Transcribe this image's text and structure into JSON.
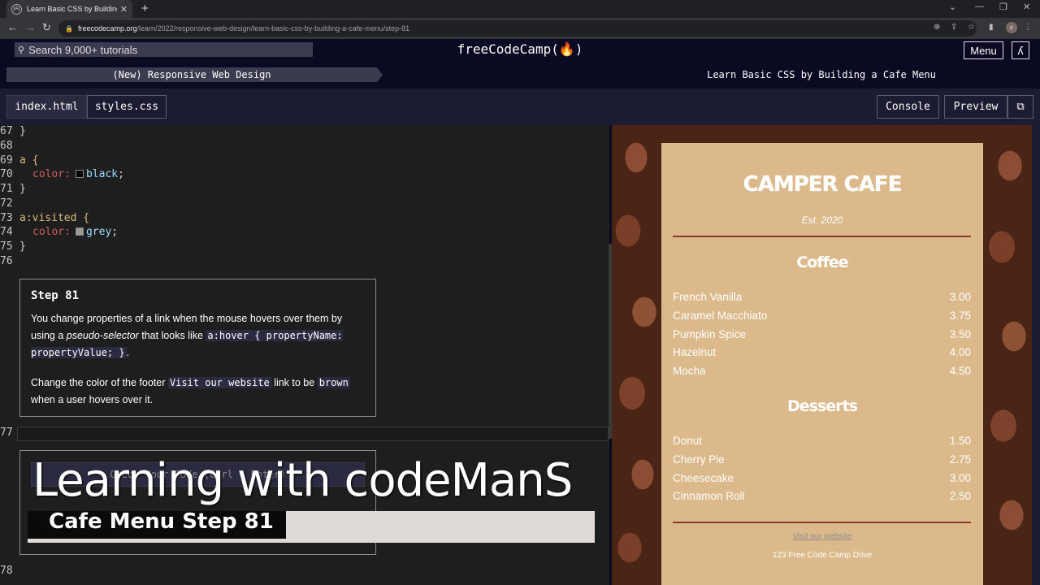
{
  "browser": {
    "tab_title": "Learn Basic CSS by Building a Cafe Menu",
    "tab_favicon": "(A)",
    "new_tab": "+",
    "url_host": "freecodecamp.org",
    "url_path": "/learn/2022/responsive-web-design/learn-basic-css-by-building-a-cafe-menu/step-81",
    "profile_initial": "c"
  },
  "nav": {
    "search_placeholder": "Search 9,000+ tutorials",
    "logo": "freeCodeCamp(🔥)",
    "menu_label": "Menu"
  },
  "breadcrumb": {
    "superblock": "(New) Responsive Web Design",
    "block": "Learn Basic CSS by Building a Cafe Menu"
  },
  "editor_tabs": {
    "files": [
      "index.html",
      "styles.css"
    ],
    "active": "styles.css",
    "console_label": "Console",
    "preview_label": "Preview"
  },
  "code_lines": [
    {
      "n": "67",
      "text": "}"
    },
    {
      "n": "68",
      "text": ""
    },
    {
      "n": "69",
      "text": "a {"
    },
    {
      "n": "70",
      "prop": "color:",
      "swatch": "#000000",
      "val": "black",
      "end": ";"
    },
    {
      "n": "71",
      "text": "}"
    },
    {
      "n": "72",
      "text": ""
    },
    {
      "n": "73",
      "text": "a:visited {"
    },
    {
      "n": "74",
      "prop": "color:",
      "swatch": "#9a9a9a",
      "val": "grey",
      "end": ";"
    },
    {
      "n": "75",
      "text": "}"
    },
    {
      "n": "76",
      "text": ""
    }
  ],
  "step": {
    "title": "Step 81",
    "p1_a": "You change properties of a link when the mouse hovers over them by using a ",
    "p1_em": "pseudo-selector",
    "p1_b": " that looks like ",
    "p1_code": "a:hover { propertyName: propertyValue; }",
    "p1_c": ".",
    "p2_a": "Change the color of the footer ",
    "p2_code1": "Visit our website",
    "p2_b": " link to be ",
    "p2_code2": "brown",
    "p2_c": " when a user hovers over it."
  },
  "line77": "77",
  "line78": "78",
  "check_button": "Check Your Code (Ctrl + Enter)",
  "preview": {
    "cafe_name": "CAMPER CAFE",
    "established": "Est. 2020",
    "coffee_heading": "Coffee",
    "coffee": [
      {
        "name": "French Vanilla",
        "price": "3.00"
      },
      {
        "name": "Caramel Macchiato",
        "price": "3.75"
      },
      {
        "name": "Pumpkin Spice",
        "price": "3.50"
      },
      {
        "name": "Hazelnut",
        "price": "4.00"
      },
      {
        "name": "Mocha",
        "price": "4.50"
      }
    ],
    "desserts_heading": "Desserts",
    "desserts": [
      {
        "name": "Donut",
        "price": "1.50"
      },
      {
        "name": "Cherry Pie",
        "price": "2.75"
      },
      {
        "name": "Cheesecake",
        "price": "3.00"
      },
      {
        "name": "Cinnamon Roll",
        "price": "2.50"
      }
    ],
    "website_link": "Visit our website",
    "address": "123 Free Code Camp Drive"
  },
  "overlay": {
    "title": "Learning with codeManS",
    "subtitle": "Cafe Menu Step 81"
  },
  "colors": {
    "fcc_dark": "#0a0a23",
    "menu_bg": "#dbb98a",
    "divider": "#8a3a2a"
  }
}
